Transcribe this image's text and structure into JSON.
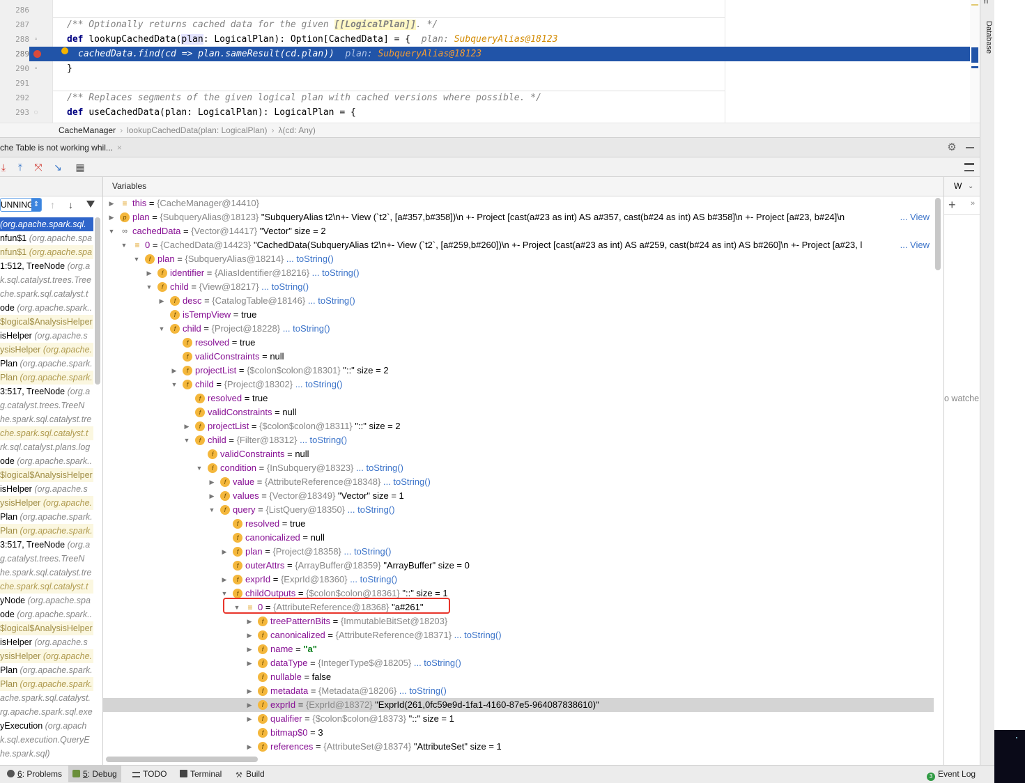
{
  "editor": {
    "lines": [
      {
        "num": "286",
        "segments": []
      },
      {
        "num": "287",
        "segments": [
          {
            "t": "/** Optionally returns cached data for the given ",
            "c": "cm"
          },
          {
            "t": "[[LogicalPlan]]",
            "c": "cmb"
          },
          {
            "t": ". */",
            "c": "cm"
          }
        ]
      },
      {
        "num": "288",
        "segments": [
          {
            "t": "def ",
            "c": "kw"
          },
          {
            "t": "lookupCachedData(",
            "c": ""
          },
          {
            "t": "plan",
            "c": "hl"
          },
          {
            "t": ": LogicalPlan): Option[CachedData] = {  ",
            "c": ""
          },
          {
            "t": "plan: ",
            "c": "hint-k"
          },
          {
            "t": "SubqueryAlias@18123",
            "c": "hint-v"
          }
        ]
      },
      {
        "num": "289",
        "segments": [
          {
            "t": "cachedData.find(cd => plan.sameResult(cd.plan))  ",
            "c": ""
          },
          {
            "t": "plan: ",
            "c": "hint-k"
          },
          {
            "t": "SubqueryAlias@18123",
            "c": "hint-v"
          }
        ]
      },
      {
        "num": "290",
        "segments": [
          {
            "t": "}",
            "c": ""
          }
        ]
      },
      {
        "num": "291",
        "segments": []
      },
      {
        "num": "292",
        "segments": [
          {
            "t": "/** Replaces segments of the given logical plan with cached versions where possible. */",
            "c": "cm"
          }
        ]
      },
      {
        "num": "293",
        "segments": [
          {
            "t": "def ",
            "c": "kw"
          },
          {
            "t": "useCachedData(plan: LogicalPlan): LogicalPlan = {",
            "c": ""
          }
        ]
      }
    ]
  },
  "breadcrumb": [
    "CacheManager",
    "lookupCachedData(plan: LogicalPlan)",
    "λ(cd: Any)"
  ],
  "debug": {
    "tab_title": "che Table is not working whil...",
    "close_glyph": "×"
  },
  "toolbar_icons": [
    "step-over-icon",
    "step-into-icon",
    "step-out-icon",
    "run-to-cursor-icon",
    "evaluate-icon",
    "table-icon"
  ],
  "frames": {
    "thread": "UNNING",
    "items": [
      {
        "name": "",
        "pk": "(org.apache.spark.sql.",
        "state": "sel"
      },
      {
        "name": "nfun$1 ",
        "pk": "(org.apache.spa",
        "state": ""
      },
      {
        "name": "nfun$1 ",
        "pk": "(org.apache.spa",
        "state": "lib"
      },
      {
        "name": "1:512, TreeNode ",
        "pk": "(org.a",
        "state": ""
      },
      {
        "name": "",
        "pk": "k.sql.catalyst.trees.Tree",
        "state": ""
      },
      {
        "name": "",
        "pk": "che.spark.sql.catalyst.t",
        "state": ""
      },
      {
        "name": "ode ",
        "pk": "(org.apache.spark..",
        "state": ""
      },
      {
        "name": "$logical$AnalysisHelper",
        "pk": "",
        "state": "lib"
      },
      {
        "name": "isHelper ",
        "pk": "(org.apache.s",
        "state": ""
      },
      {
        "name": "ysisHelper ",
        "pk": "(org.apache.",
        "state": "lib"
      },
      {
        "name": "Plan ",
        "pk": "(org.apache.spark.",
        "state": ""
      },
      {
        "name": "Plan ",
        "pk": "(org.apache.spark.",
        "state": "lib"
      },
      {
        "name": "3:517, TreeNode ",
        "pk": "(org.a",
        "state": ""
      },
      {
        "name": "",
        "pk": "g.catalyst.trees.TreeN",
        "state": ""
      },
      {
        "name": "",
        "pk": "he.spark.sql.catalyst.tre",
        "state": ""
      },
      {
        "name": "",
        "pk": "che.spark.sql.catalyst.t",
        "state": "lib"
      },
      {
        "name": "",
        "pk": "rk.sql.catalyst.plans.log",
        "state": ""
      },
      {
        "name": "ode ",
        "pk": "(org.apache.spark..",
        "state": ""
      },
      {
        "name": "$logical$AnalysisHelper",
        "pk": "",
        "state": "lib"
      },
      {
        "name": "isHelper ",
        "pk": "(org.apache.s",
        "state": ""
      },
      {
        "name": "ysisHelper ",
        "pk": "(org.apache.",
        "state": "lib"
      },
      {
        "name": "Plan ",
        "pk": "(org.apache.spark.",
        "state": ""
      },
      {
        "name": "Plan ",
        "pk": "(org.apache.spark.",
        "state": "lib"
      },
      {
        "name": "3:517, TreeNode ",
        "pk": "(org.a",
        "state": ""
      },
      {
        "name": "",
        "pk": "g.catalyst.trees.TreeN",
        "state": ""
      },
      {
        "name": "",
        "pk": "he.spark.sql.catalyst.tre",
        "state": ""
      },
      {
        "name": "",
        "pk": "che.spark.sql.catalyst.t",
        "state": "lib"
      },
      {
        "name": "yNode ",
        "pk": "(org.apache.spa",
        "state": ""
      },
      {
        "name": "ode ",
        "pk": "(org.apache.spark..",
        "state": ""
      },
      {
        "name": "$logical$AnalysisHelper",
        "pk": "",
        "state": "lib"
      },
      {
        "name": "isHelper ",
        "pk": "(org.apache.s",
        "state": ""
      },
      {
        "name": "ysisHelper ",
        "pk": "(org.apache.",
        "state": "lib"
      },
      {
        "name": "Plan ",
        "pk": "(org.apache.spark.",
        "state": ""
      },
      {
        "name": "Plan ",
        "pk": "(org.apache.spark.",
        "state": "lib"
      },
      {
        "name": "",
        "pk": "ache.spark.sql.catalyst.",
        "state": ""
      },
      {
        "name": "",
        "pk": "rg.apache.spark.sql.exe",
        "state": ""
      },
      {
        "name": "yExecution ",
        "pk": "(org.apach",
        "state": ""
      },
      {
        "name": "",
        "pk": "k.sql.execution.QueryE",
        "state": ""
      },
      {
        "name": "",
        "pk": "he.spark.sql)",
        "state": ""
      }
    ]
  },
  "variables": {
    "title": "Variables",
    "view_label": "View",
    "rows": [
      {
        "d": 0,
        "tri": "▶",
        "ic": "list",
        "name": "this",
        "type": "{CacheManager@14410}",
        "val": "",
        "link": ""
      },
      {
        "d": 0,
        "tri": "▶",
        "ic": "p",
        "name": "plan",
        "type": "{SubqueryAlias@18123}",
        "val": " \"SubqueryAlias t2\\n+- View (`t2`, [a#357,b#358])\\n   +- Project [cast(a#23 as int) AS a#357, cast(b#24 as int) AS b#358]\\n      +- Project [a#23, b#24]\\n ",
        "link": "",
        "view": true
      },
      {
        "d": 0,
        "tri": "▼",
        "ic": "oo",
        "name": "cachedData",
        "type": "{Vector@14417}",
        "val": " \"Vector\" size = 2",
        "link": ""
      },
      {
        "d": 1,
        "tri": "▼",
        "ic": "list",
        "name": "0",
        "type": "{CachedData@14423}",
        "val": " \"CachedData(SubqueryAlias t2\\n+- View (`t2`, [a#259,b#260])\\n   +- Project [cast(a#23 as int) AS a#259, cast(b#24 as int) AS b#260]\\n      +- Project [a#23, l",
        "link": "",
        "view": true
      },
      {
        "d": 2,
        "tri": "▼",
        "ic": "f",
        "name": "plan",
        "type": "{SubqueryAlias@18214}",
        "val": "",
        "link": "... toString()"
      },
      {
        "d": 3,
        "tri": "▶",
        "ic": "f",
        "name": "identifier",
        "type": "{AliasIdentifier@18216}",
        "val": "",
        "link": "... toString()"
      },
      {
        "d": 3,
        "tri": "▼",
        "ic": "f",
        "name": "child",
        "type": "{View@18217}",
        "val": "",
        "link": "... toString()"
      },
      {
        "d": 4,
        "tri": "▶",
        "ic": "f",
        "name": "desc",
        "type": "{CatalogTable@18146}",
        "val": "",
        "link": "... toString()"
      },
      {
        "d": 4,
        "tri": "",
        "ic": "f",
        "name": "isTempView",
        "type": "",
        "val": "true",
        "link": ""
      },
      {
        "d": 4,
        "tri": "▼",
        "ic": "f",
        "name": "child",
        "type": "{Project@18228}",
        "val": "",
        "link": "... toString()"
      },
      {
        "d": 5,
        "tri": "",
        "ic": "f",
        "name": "resolved",
        "type": "",
        "val": "true",
        "link": ""
      },
      {
        "d": 5,
        "tri": "",
        "ic": "f",
        "name": "validConstraints",
        "type": "",
        "val": "null",
        "link": ""
      },
      {
        "d": 5,
        "tri": "▶",
        "ic": "f",
        "name": "projectList",
        "type": "{$colon$colon@18301}",
        "val": " \"::\" size = 2",
        "link": ""
      },
      {
        "d": 5,
        "tri": "▼",
        "ic": "f",
        "name": "child",
        "type": "{Project@18302}",
        "val": "",
        "link": "... toString()"
      },
      {
        "d": 6,
        "tri": "",
        "ic": "f",
        "name": "resolved",
        "type": "",
        "val": "true",
        "link": ""
      },
      {
        "d": 6,
        "tri": "",
        "ic": "f",
        "name": "validConstraints",
        "type": "",
        "val": "null",
        "link": ""
      },
      {
        "d": 6,
        "tri": "▶",
        "ic": "f",
        "name": "projectList",
        "type": "{$colon$colon@18311}",
        "val": " \"::\" size = 2",
        "link": ""
      },
      {
        "d": 6,
        "tri": "▼",
        "ic": "f",
        "name": "child",
        "type": "{Filter@18312}",
        "val": "",
        "link": "... toString()"
      },
      {
        "d": 7,
        "tri": "",
        "ic": "f",
        "name": "validConstraints",
        "type": "",
        "val": "null",
        "link": ""
      },
      {
        "d": 7,
        "tri": "▼",
        "ic": "f",
        "name": "condition",
        "type": "{InSubquery@18323}",
        "val": "",
        "link": "... toString()"
      },
      {
        "d": 8,
        "tri": "▶",
        "ic": "f",
        "name": "value",
        "type": "{AttributeReference@18348}",
        "val": "",
        "link": "... toString()"
      },
      {
        "d": 8,
        "tri": "▶",
        "ic": "f",
        "name": "values",
        "type": "{Vector@18349}",
        "val": " \"Vector\" size = 1",
        "link": ""
      },
      {
        "d": 8,
        "tri": "▼",
        "ic": "f",
        "name": "query",
        "type": "{ListQuery@18350}",
        "val": "",
        "link": "... toString()"
      },
      {
        "d": 9,
        "tri": "",
        "ic": "f",
        "name": "resolved",
        "type": "",
        "val": "true",
        "link": ""
      },
      {
        "d": 9,
        "tri": "",
        "ic": "f",
        "name": "canonicalized",
        "type": "",
        "val": "null",
        "link": ""
      },
      {
        "d": 9,
        "tri": "▶",
        "ic": "f",
        "name": "plan",
        "type": "{Project@18358}",
        "val": "",
        "link": "... toString()"
      },
      {
        "d": 9,
        "tri": "",
        "ic": "f",
        "name": "outerAttrs",
        "type": "{ArrayBuffer@18359}",
        "val": " \"ArrayBuffer\" size = 0",
        "link": ""
      },
      {
        "d": 9,
        "tri": "▶",
        "ic": "f",
        "name": "exprId",
        "type": "{ExprId@18360}",
        "val": "",
        "link": "... toString()"
      },
      {
        "d": 9,
        "tri": "▼",
        "ic": "f",
        "name": "childOutputs",
        "type": "{$colon$colon@18361}",
        "val": " \"::\" size = 1",
        "link": ""
      },
      {
        "d": 10,
        "tri": "▼",
        "ic": "list",
        "name": "0",
        "type": "{AttributeReference@18368}",
        "val": " \"a#261\"",
        "link": ""
      },
      {
        "d": 11,
        "tri": "▶",
        "ic": "f",
        "name": "treePatternBits",
        "type": "{ImmutableBitSet@18203}",
        "val": "",
        "link": ""
      },
      {
        "d": 11,
        "tri": "▶",
        "ic": "f",
        "name": "canonicalized",
        "type": "{AttributeReference@18371}",
        "val": "",
        "link": "... toString()"
      },
      {
        "d": 11,
        "tri": "▶",
        "ic": "f",
        "name": "name",
        "type": "",
        "val": "",
        "str": "\"a\"",
        "link": ""
      },
      {
        "d": 11,
        "tri": "▶",
        "ic": "f",
        "name": "dataType",
        "type": "{IntegerType$@18205}",
        "val": "",
        "link": "... toString()"
      },
      {
        "d": 11,
        "tri": "",
        "ic": "f",
        "name": "nullable",
        "type": "",
        "val": "false",
        "link": ""
      },
      {
        "d": 11,
        "tri": "▶",
        "ic": "f",
        "name": "metadata",
        "type": "{Metadata@18206}",
        "val": "",
        "link": "... toString()"
      },
      {
        "d": 11,
        "tri": "▶",
        "ic": "f",
        "name": "exprId",
        "type": "{ExprId@18372}",
        "val": " \"ExprId(261,0fc59e9d-1fa1-4160-87e5-964087838610)\"",
        "link": "",
        "sel": true
      },
      {
        "d": 11,
        "tri": "▶",
        "ic": "f",
        "name": "qualifier",
        "type": "{$colon$colon@18373}",
        "val": " \"::\" size = 1",
        "link": ""
      },
      {
        "d": 11,
        "tri": "",
        "ic": "f",
        "name": "bitmap$0",
        "type": "",
        "val": "3",
        "link": ""
      },
      {
        "d": 11,
        "tri": "▶",
        "ic": "f",
        "name": "references",
        "type": "{AttributeSet@18374}",
        "val": " \"AttributeSet\" size = 1",
        "link": ""
      }
    ]
  },
  "watches": {
    "title": "W",
    "empty_text": "o watche"
  },
  "right_stripe": {
    "top_label": "n",
    "database_label": "Database"
  },
  "status_bar": {
    "tabs": [
      {
        "num": "6",
        "label": ": Problems",
        "icon": "problems-icon"
      },
      {
        "num": "5",
        "label": ": Debug",
        "icon": "debug-icon",
        "active": true
      },
      {
        "num": "",
        "label": "TODO",
        "icon": "todo-icon"
      },
      {
        "num": "",
        "label": "Terminal",
        "icon": "terminal-icon"
      },
      {
        "num": "",
        "label": "Build",
        "icon": "build-icon"
      }
    ],
    "event_log": "Event Log"
  }
}
